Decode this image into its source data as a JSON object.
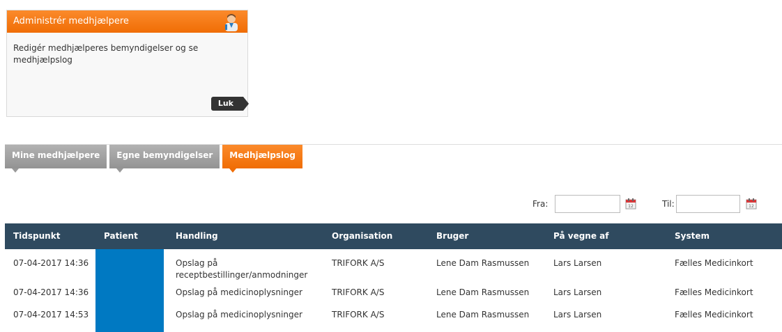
{
  "card": {
    "title": "Administrér medhjælpere",
    "description": "Redigér medhjælperes bemyndigelser og se medhjælpslog",
    "close_label": "Luk"
  },
  "tabs": [
    {
      "label": "Mine medhjælpere",
      "active": false
    },
    {
      "label": "Egne bemyndigelser",
      "active": false
    },
    {
      "label": "Medhjælpslog",
      "active": true
    }
  ],
  "filter": {
    "from_label": "Fra:",
    "from_value": "",
    "to_label": "Til:",
    "to_value": ""
  },
  "table": {
    "headers": [
      "Tidspunkt",
      "Patient",
      "Handling",
      "Organisation",
      "Bruger",
      "På vegne af",
      "System"
    ],
    "rows": [
      {
        "time": "07-04-2017 14:36",
        "patient": "",
        "action": "Opslag på receptbestillinger/anmodninger",
        "org": "TRIFORK A/S",
        "user": "Lene Dam Rasmussen",
        "on_behalf": "Lars Larsen",
        "system": "Fælles Medicinkort"
      },
      {
        "time": "07-04-2017 14:36",
        "patient": "",
        "action": "Opslag på medicinoplysninger",
        "org": "TRIFORK A/S",
        "user": "Lene Dam Rasmussen",
        "on_behalf": "Lars Larsen",
        "system": "Fælles Medicinkort"
      },
      {
        "time": "07-04-2017 14:53",
        "patient": "",
        "action": "Opslag på medicinoplysninger",
        "org": "TRIFORK A/S",
        "user": "Lene Dam Rasmussen",
        "on_behalf": "Lars Larsen",
        "system": "Fælles Medicinkort"
      }
    ]
  },
  "colors": {
    "accent": "#f06d05",
    "header_bg": "#2f4a5f",
    "tab_grey": "#999999",
    "redaction": "#0079c2"
  },
  "icons": {
    "card": "doctor-avatar-icon",
    "calendar": "calendar-icon"
  }
}
